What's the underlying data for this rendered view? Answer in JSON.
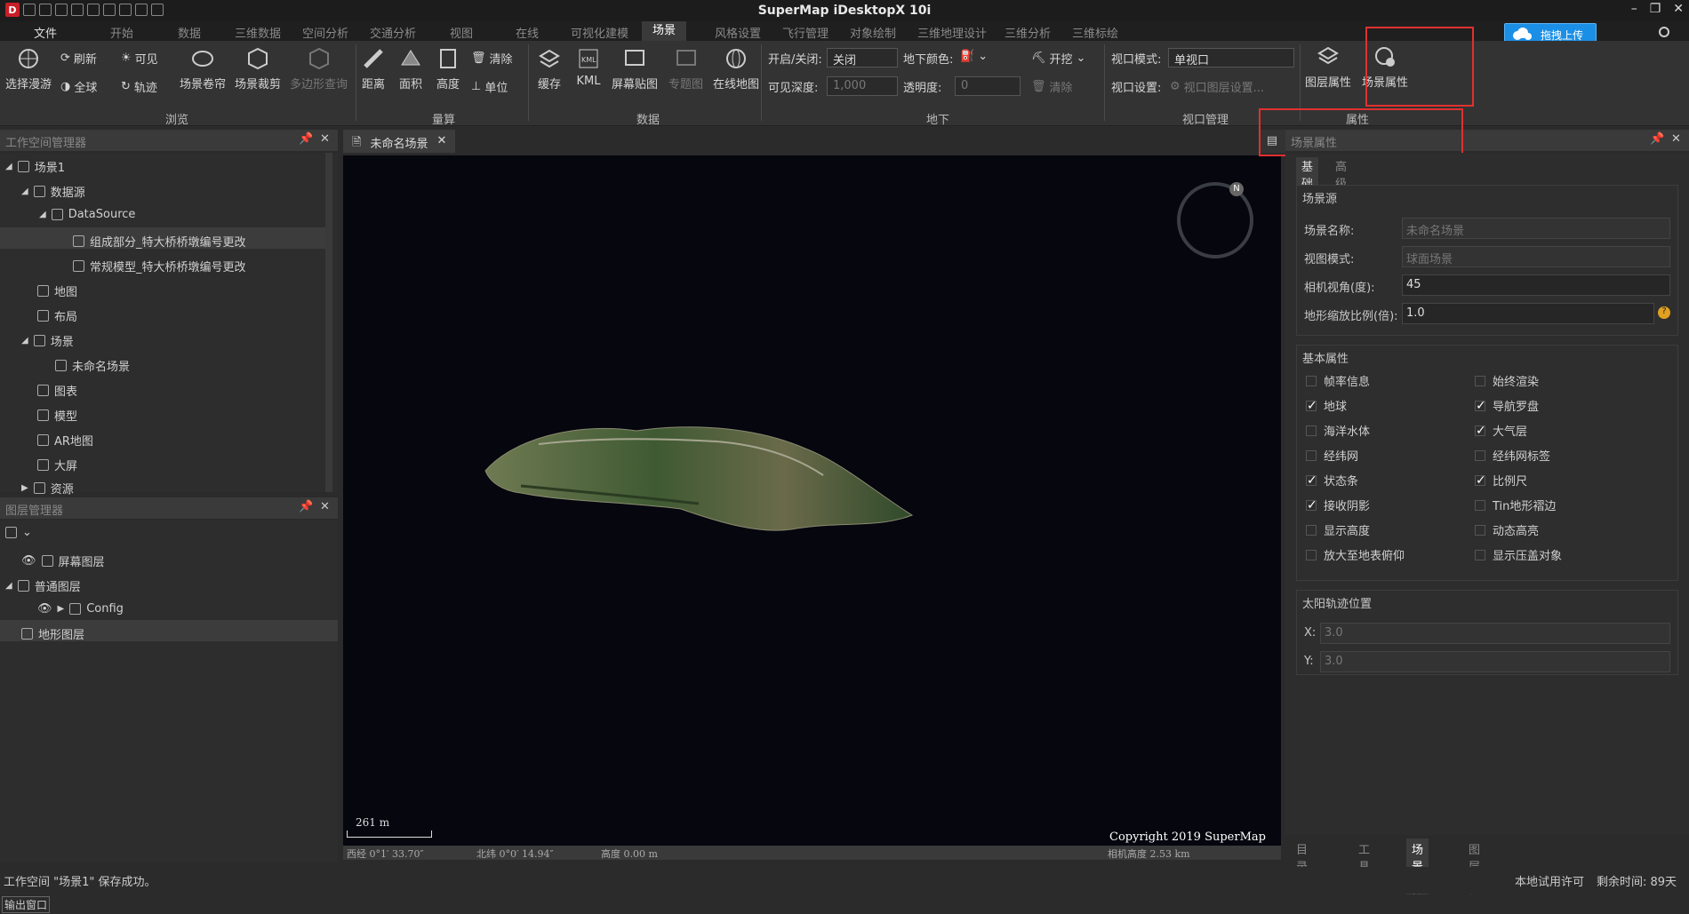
{
  "app_title": "SuperMap iDesktopX 10i",
  "menubar": {
    "items": [
      "文件",
      "开始",
      "数据",
      "三维数据",
      "空间分析",
      "交通分析",
      "视图",
      "在线",
      "可视化建模",
      "场景",
      "风格设置",
      "飞行管理",
      "对象绘制",
      "三维地理设计",
      "三维分析",
      "三维标绘"
    ],
    "active": "场景"
  },
  "upload_label": "拖拽上传",
  "ribbon": {
    "browse": {
      "select_roam": "选择漫游",
      "refresh": "刷新",
      "full_extent": "全球",
      "visible": "可见",
      "track": "轨迹",
      "scene_roll": "场景卷帘",
      "scene_clip": "场景裁剪",
      "polygon_query": "多边形查询",
      "group": "浏览"
    },
    "measure": {
      "distance": "距离",
      "area": "面积",
      "height": "高度",
      "clear": "清除",
      "unit": "单位",
      "group": "量算"
    },
    "data": {
      "cache": "缓存",
      "kml": "KML",
      "screen_map": "屏幕贴图",
      "thematic": "专题图",
      "online_map": "在线地图",
      "group": "数据"
    },
    "underground": {
      "toggle_label": "开启/关闭:",
      "toggle_value": "关闭",
      "color_label": "地下颜色:",
      "dig": "开挖",
      "depth_label": "可见深度:",
      "depth_value": "1,000",
      "opacity_label": "透明度:",
      "opacity_value": "0",
      "clear": "清除",
      "group": "地下"
    },
    "viewport": {
      "mode_label": "视口模式:",
      "mode_value": "单视口",
      "setting_label": "视口设置:",
      "setting_value": "视口图层设置...",
      "group": "视口管理"
    },
    "properties": {
      "layer_props": "图层属性",
      "scene_props": "场景属性",
      "group": "属性"
    }
  },
  "workspace_panel": {
    "title": "工作空间管理器",
    "tree": [
      "场景1",
      "数据源",
      "DataSource",
      "组成部分_特大桥桥墩编号更改",
      "常规模型_特大桥桥墩编号更改",
      "地图",
      "布局",
      "场景",
      "未命名场景",
      "图表",
      "模型",
      "AR地图",
      "大屏",
      "资源"
    ]
  },
  "layer_panel": {
    "title": "图层管理器",
    "tree": [
      "屏幕图层",
      "普通图层",
      "Config",
      "地形图层"
    ]
  },
  "doc_tab": "未命名场景",
  "viewport": {
    "scale_text": "261 m",
    "copyright": "Copyright 2019 SuperMap",
    "lon": "西经 0°1′ 33.70″",
    "lat": "北纬 0°0′ 14.94″",
    "altitude": "高度 0.00 m",
    "camera_height": "相机高度 2.53 km",
    "compass_letter": "N"
  },
  "scene_panel": {
    "title": "场景属性",
    "tabs": [
      "基础",
      "高级"
    ],
    "source_section": "场景源",
    "fields": [
      {
        "label": "场景名称:",
        "value": "未命名场景"
      },
      {
        "label": "视图模式:",
        "value": "球面场景"
      },
      {
        "label": "相机视角(度):",
        "value": "45"
      },
      {
        "label": "地形缩放比例(倍):",
        "value": "1.0"
      }
    ],
    "basic_section": "基本属性",
    "checks_left": [
      {
        "label": "帧率信息",
        "checked": false
      },
      {
        "label": "地球",
        "checked": true
      },
      {
        "label": "海洋水体",
        "checked": false
      },
      {
        "label": "经纬网",
        "checked": false
      },
      {
        "label": "状态条",
        "checked": true
      },
      {
        "label": "接收阴影",
        "checked": true
      },
      {
        "label": "显示高度",
        "checked": false
      },
      {
        "label": "放大至地表俯仰",
        "checked": false
      }
    ],
    "checks_right": [
      {
        "label": "始终渲染",
        "checked": false
      },
      {
        "label": "导航罗盘",
        "checked": true
      },
      {
        "label": "大气层",
        "checked": true
      },
      {
        "label": "经纬网标签",
        "checked": false
      },
      {
        "label": "比例尺",
        "checked": true
      },
      {
        "label": "Tin地形褶边",
        "checked": false
      },
      {
        "label": "动态高亮",
        "checked": false
      },
      {
        "label": "显示压盖对象",
        "checked": false
      }
    ],
    "sun_section": "太阳轨迹位置",
    "sun_x_label": "X:",
    "sun_x": "3.0",
    "sun_y_label": "Y:",
    "sun_y": "3.0",
    "bottom_tabs": [
      "目录管理",
      "工具箱",
      "场景属性",
      "图层属性"
    ]
  },
  "status": {
    "message": "工作空间 \"场景1\" 保存成功。",
    "license": "本地试用许可",
    "remaining": "剩余时间: 89天"
  },
  "output_window": "输出窗口",
  "colors": {
    "accent": "#1b8fe6",
    "highlight": "#e03030"
  }
}
